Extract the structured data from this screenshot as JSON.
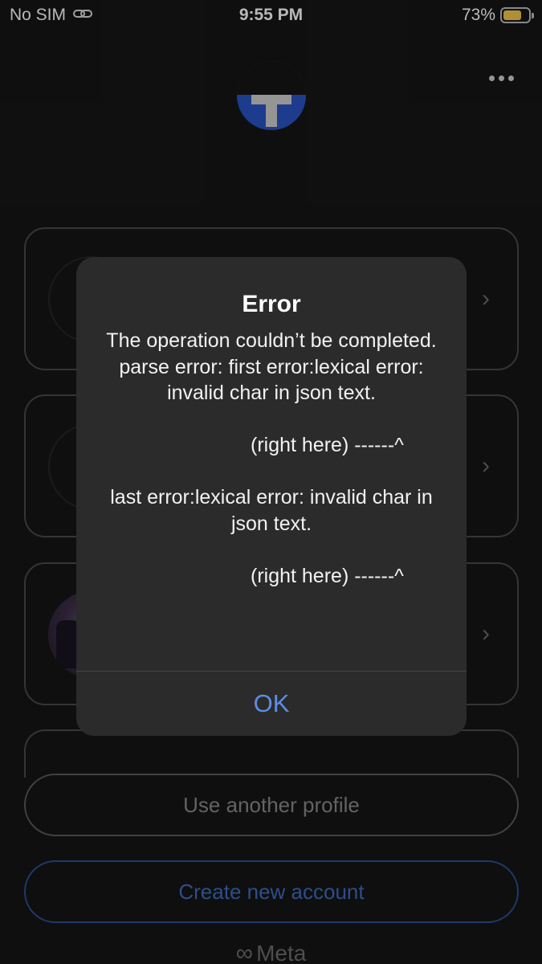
{
  "status_bar": {
    "carrier": "No SIM",
    "link_icon": "link-icon",
    "time": "9:55 PM",
    "battery_percent": "73%",
    "battery_level": 0.73,
    "battery_color": "#f5c84a"
  },
  "header": {
    "more_icon": "more-horizontal-icon"
  },
  "profiles": [
    {
      "chevron": "›"
    },
    {
      "chevron": "›"
    },
    {
      "chevron": "›"
    }
  ],
  "buttons": {
    "use_another_profile": "Use another profile",
    "create_new_account": "Create new account"
  },
  "footer": {
    "logo_mark": "∞",
    "logo_text": "Meta"
  },
  "alert": {
    "title": "Error",
    "message": "The operation couldn’t be completed. parse error: first error:lexical error: invalid char in json text.\n\n                    (right here) ------^\n\nlast error:lexical error: invalid char in json text.\n\n                    (right here) ------^",
    "ok_label": "OK",
    "ok_color": "#5b8fe6"
  },
  "colors": {
    "background": "#161616",
    "accent_blue": "#3f6dbd",
    "alert_bg": "#2b2b2b"
  }
}
